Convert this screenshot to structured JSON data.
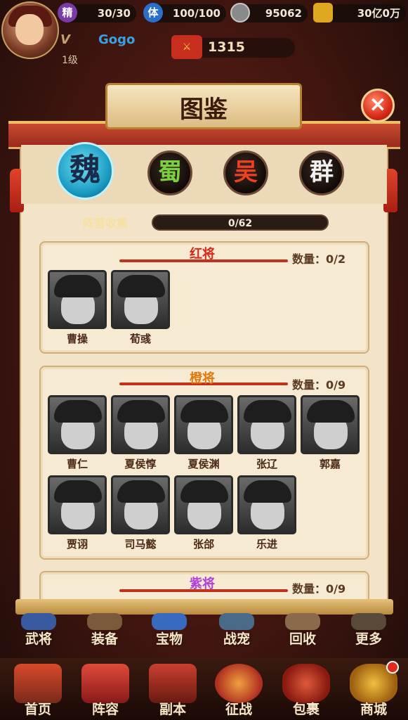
{
  "status": {
    "stamina_icon": "精",
    "stamina": "30/30",
    "energy_icon": "体",
    "energy": "100/100",
    "coins": "95062",
    "gold": "30亿0万"
  },
  "player": {
    "vip": "V",
    "name": "Gogo",
    "level": "1级",
    "power": "1315"
  },
  "panel": {
    "title": "图鉴",
    "close_icon": "×",
    "kingdoms": [
      "魏",
      "蜀",
      "吴",
      "群"
    ],
    "active_kingdom": "魏",
    "collect_label": "阵营收集",
    "progress": "0/62"
  },
  "sections": [
    {
      "title": "红将",
      "title_color": "#d8281a",
      "count_label": "数量：",
      "count": "0/2",
      "heroes": [
        "曹操",
        "荀彧"
      ]
    },
    {
      "title": "橙将",
      "title_color": "#e07a10",
      "count_label": "数量：",
      "count": "0/9",
      "heroes": [
        "曹仁",
        "夏侯惇",
        "夏侯渊",
        "张辽",
        "郭嘉",
        "贾诩",
        "司马懿",
        "张郃",
        "乐进"
      ]
    },
    {
      "title": "紫将",
      "title_color": "#b040d8",
      "count_label": "数量：",
      "count": "0/9",
      "heroes": []
    }
  ],
  "menu_row1": [
    "武将",
    "装备",
    "宝物",
    "战宠",
    "回收",
    "更多"
  ],
  "menu_row2": [
    "首页",
    "阵容",
    "副本",
    "征战",
    "包裹",
    "商城"
  ]
}
